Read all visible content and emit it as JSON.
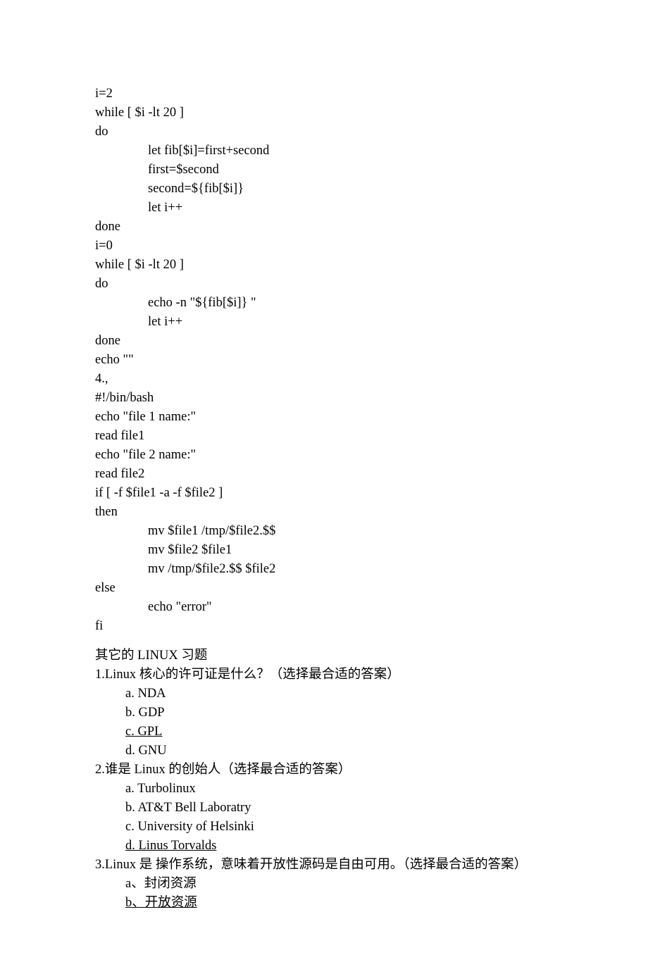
{
  "code": {
    "l1": "i=2",
    "l2": "while [ $i -lt 20 ]",
    "l3": "do",
    "l4": "let fib[$i]=first+second",
    "l5": "first=$second",
    "l6": "second=${fib[$i]}",
    "l7": "let i++",
    "l8": "done",
    "l9": "i=0",
    "l10": "while [ $i -lt 20 ]",
    "l11": "do",
    "l12": "echo -n \"${fib[$i]} \"",
    "l13": "let i++",
    "l14": "done",
    "l15": "echo \"\"",
    "l16": "4.,",
    "l17": "#!/bin/bash",
    "l18": "echo \"file 1 name:\"",
    "l19": "read file1",
    "l20": "echo \"file 2 name:\"",
    "l21": "read file2",
    "l22": "if [ -f $file1 -a -f $file2 ]",
    "l23": "then",
    "l24": "mv $file1 /tmp/$file2.$$",
    "l25": "mv $file2 $file1",
    "l26": "mv /tmp/$file2.$$ $file2",
    "l27": "else",
    "l28": "echo \"error\"",
    "l29": "fi"
  },
  "heading": {
    "zh1": "其它的 ",
    "en": "LINUX ",
    "zh2": "习题"
  },
  "q1": {
    "text": "1.Linux 核心的许可证是什么？（选择最合适的答案）",
    "a": "a. NDA",
    "b": "b. GDP",
    "c": "c. GPL",
    "d": "d. GNU"
  },
  "q2": {
    "text": "2.谁是 Linux 的创始人（选择最合适的答案）",
    "a": "a. Turbolinux",
    "b": "b. AT&T Bell Laboratry",
    "c": "c. University of Helsinki",
    "d": "d. Linus Torvalds"
  },
  "q3": {
    "text": "3.Linux 是  操作系统，意味着开放性源码是自由可用。（选择最合适的答案）",
    "a": "a、封闭资源",
    "b": "b、开放资源"
  }
}
